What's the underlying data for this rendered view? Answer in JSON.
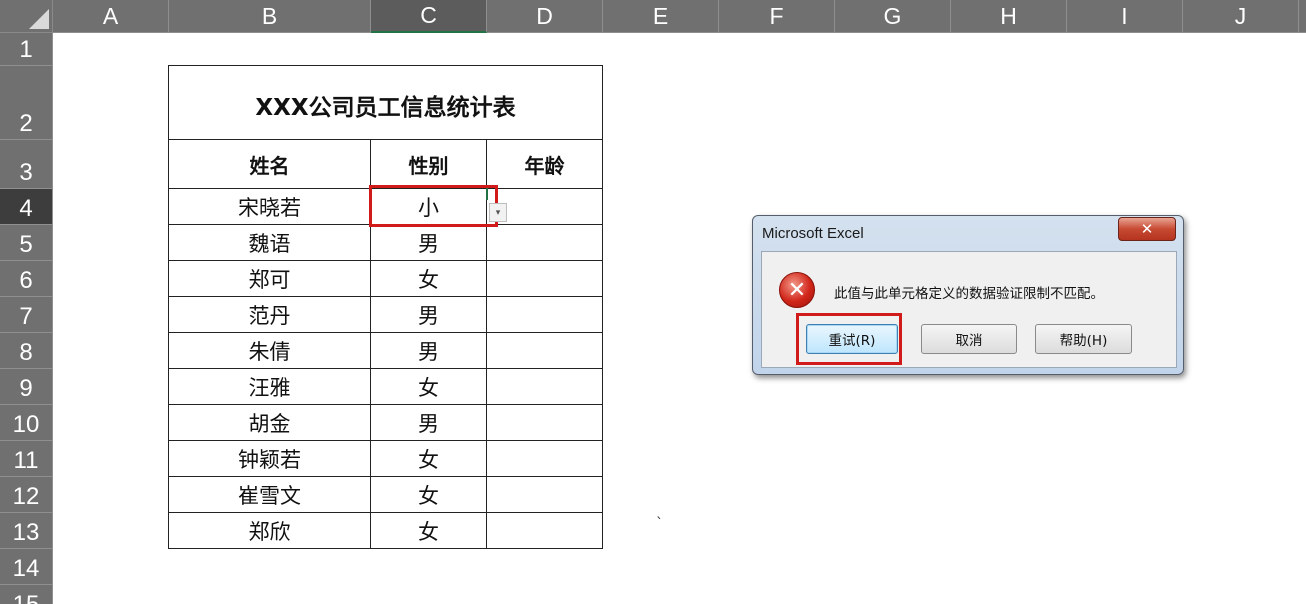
{
  "columns": [
    "A",
    "B",
    "C",
    "D",
    "E",
    "F",
    "G",
    "H",
    "I",
    "J"
  ],
  "active_column": "C",
  "rows": [
    "1",
    "2",
    "3",
    "4",
    "5",
    "6",
    "7",
    "8",
    "9",
    "10",
    "11",
    "12",
    "13",
    "14",
    "15"
  ],
  "active_row": "4",
  "table": {
    "title": "XXX公司员工信息统计表",
    "headers": [
      "姓名",
      "性别",
      "年龄"
    ],
    "records": [
      {
        "name": "宋晓若",
        "gender": "小",
        "age": ""
      },
      {
        "name": "魏语",
        "gender": "男",
        "age": ""
      },
      {
        "name": "郑可",
        "gender": "女",
        "age": ""
      },
      {
        "name": "范丹",
        "gender": "男",
        "age": ""
      },
      {
        "name": "朱倩",
        "gender": "男",
        "age": ""
      },
      {
        "name": "汪雅",
        "gender": "女",
        "age": ""
      },
      {
        "name": "胡金",
        "gender": "男",
        "age": ""
      },
      {
        "name": "钟颖若",
        "gender": "女",
        "age": ""
      },
      {
        "name": "崔雪文",
        "gender": "女",
        "age": ""
      },
      {
        "name": "郑欣",
        "gender": "女",
        "age": ""
      }
    ]
  },
  "stray_mark": "`",
  "dialog": {
    "title": "Microsoft Excel",
    "close_glyph": "✕",
    "icon": "error-icon",
    "icon_glyph": "✕",
    "message": "此值与此单元格定义的数据验证限制不匹配。",
    "buttons": {
      "retry": "重试(R)",
      "cancel": "取消",
      "help": "帮助(H)"
    }
  },
  "colors": {
    "header_bg": "#707070",
    "highlight_red": "#d11a1a",
    "excel_green": "#217346"
  }
}
